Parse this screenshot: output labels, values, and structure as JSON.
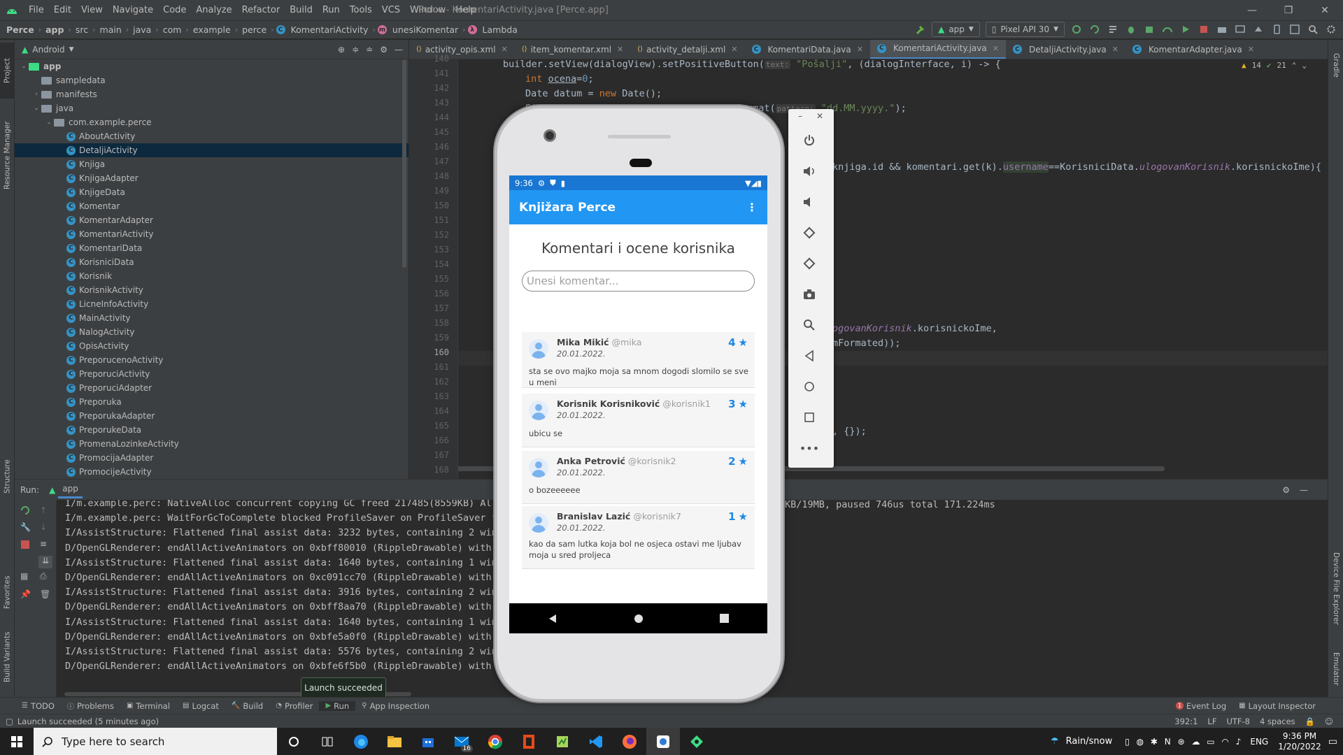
{
  "menu": {
    "items": [
      "File",
      "Edit",
      "View",
      "Navigate",
      "Code",
      "Analyze",
      "Refactor",
      "Build",
      "Run",
      "Tools",
      "VCS",
      "Window",
      "Help"
    ]
  },
  "window_title": "Perce - KomentariActivity.java [Perce.app]",
  "breadcrumb": [
    "Perce",
    "app",
    "src",
    "main",
    "java",
    "com",
    "example",
    "perce",
    "KomentariActivity",
    "unesiKomentar",
    "Lambda"
  ],
  "toolbar": {
    "run_config": "app",
    "device": "Pixel API 30"
  },
  "project_panel": {
    "view_mode": "Android",
    "tree": [
      {
        "label": "app",
        "type": "folder",
        "depth": 0,
        "open": true
      },
      {
        "label": "sampledata",
        "type": "folder",
        "depth": 1
      },
      {
        "label": "manifests",
        "type": "folder",
        "depth": 1,
        "collapsed": true
      },
      {
        "label": "java",
        "type": "folder",
        "depth": 1,
        "open": true
      },
      {
        "label": "com.example.perce",
        "type": "package",
        "depth": 2,
        "open": true
      },
      {
        "label": "AboutActivity",
        "type": "class",
        "depth": 3
      },
      {
        "label": "DetaljiActivity",
        "type": "class",
        "depth": 3,
        "selected": true
      },
      {
        "label": "Knjiga",
        "type": "class",
        "depth": 3
      },
      {
        "label": "KnjigaAdapter",
        "type": "class",
        "depth": 3
      },
      {
        "label": "KnjigeData",
        "type": "class",
        "depth": 3
      },
      {
        "label": "Komentar",
        "type": "class",
        "depth": 3
      },
      {
        "label": "KomentarAdapter",
        "type": "class",
        "depth": 3
      },
      {
        "label": "KomentariActivity",
        "type": "class",
        "depth": 3
      },
      {
        "label": "KomentariData",
        "type": "class",
        "depth": 3
      },
      {
        "label": "KorisniciData",
        "type": "class",
        "depth": 3
      },
      {
        "label": "Korisnik",
        "type": "class",
        "depth": 3
      },
      {
        "label": "KorisnikActivity",
        "type": "class",
        "depth": 3
      },
      {
        "label": "LicneInfoActivity",
        "type": "class",
        "depth": 3
      },
      {
        "label": "MainActivity",
        "type": "class",
        "depth": 3
      },
      {
        "label": "NalogActivity",
        "type": "class",
        "depth": 3
      },
      {
        "label": "OpisActivity",
        "type": "class",
        "depth": 3
      },
      {
        "label": "PreporucenoActivity",
        "type": "class",
        "depth": 3
      },
      {
        "label": "PreporuciActivity",
        "type": "class",
        "depth": 3
      },
      {
        "label": "PreporuciAdapter",
        "type": "class",
        "depth": 3
      },
      {
        "label": "Preporuka",
        "type": "class",
        "depth": 3
      },
      {
        "label": "PreporukaAdapter",
        "type": "class",
        "depth": 3
      },
      {
        "label": "PreporukeData",
        "type": "class",
        "depth": 3
      },
      {
        "label": "PromenaLozinkeActivity",
        "type": "class",
        "depth": 3
      },
      {
        "label": "PromocijaAdapter",
        "type": "class",
        "depth": 3
      },
      {
        "label": "PromocijeActivity",
        "type": "class",
        "depth": 3
      }
    ]
  },
  "editor_tabs": [
    {
      "label": "activity_opis.xml",
      "kind": "xml"
    },
    {
      "label": "item_komentar.xml",
      "kind": "xml"
    },
    {
      "label": "activity_detalji.xml",
      "kind": "xml"
    },
    {
      "label": "KomentariData.java",
      "kind": "java"
    },
    {
      "label": "KomentariActivity.java",
      "kind": "java",
      "active": true
    },
    {
      "label": "DetaljiActivity.java",
      "kind": "java"
    },
    {
      "label": "KomentarAdapter.java",
      "kind": "java"
    }
  ],
  "editor": {
    "line_numbers": [
      "140",
      "141",
      "142",
      "143",
      "144",
      "145",
      "146",
      "147",
      "148",
      "149",
      "150",
      "151",
      "152",
      "153",
      "154",
      "155",
      "156",
      "157",
      "158",
      "159",
      "160",
      "161",
      "162",
      "163",
      "164",
      "165",
      "166",
      "167",
      "168"
    ],
    "current_line": "160",
    "warnings": "14",
    "checks": "21",
    "code": {
      "l140a": "builder.setView(dialogView).setPositiveButton(",
      "l140hint": "text:",
      "l140str": "\"Pošalji\"",
      "l140b": ", (dialogInterface, i) -> {",
      "l141kw": "int",
      "l141var": "ocena",
      "l141rest": "=",
      "l141num": "0",
      "l142a": "Date datum = ",
      "l142kw": "new",
      "l142b": " Date();",
      "l143a": "SimpleDateFormat sdf = ",
      "l143kw": "new",
      "l143b": " SimpleDateFormat(",
      "l143hint": "pattern:",
      "l143str": "\"dd.MM.yyyy.\"",
      "l143c": ");",
      "l147a": "knjiga.id && komentari.get(k).",
      "l147fld": "username",
      "l147b": "==KorisniciData.",
      "l147fld2": "ulogovanKorisnik",
      "l147c": ".korisnickoIme){",
      "l158a": "ogovanKorisnik",
      "l158b": ".korisnickoIme,",
      "l159": "mFormated));",
      "l167": ", {});"
    }
  },
  "run_panel": {
    "label": "Run:",
    "config": "app",
    "lines": [
      "I/m.example.perc: NativeAlloc concurrent copying GC freed 217485(8559KB) Allo",
      "I/m.example.perc: WaitForGcToComplete blocked ProfileSaver on ProfileSaver fo",
      "I/AssistStructure: Flattened final assist data: 3232 bytes, containing 2 wind",
      "D/OpenGLRenderer: endAllActiveAnimators on 0xbff80010 (RippleDrawable) with h",
      "I/AssistStructure: Flattened final assist data: 1640 bytes, containing 1 wind",
      "D/OpenGLRenderer: endAllActiveAnimators on 0xc091cc70 (RippleDrawable) with h",
      "I/AssistStructure: Flattened final assist data: 3916 bytes, containing 2 wind",
      "D/OpenGLRenderer: endAllActiveAnimators on 0xbff8aa70 (RippleDrawable) with h",
      "I/AssistStructure: Flattened final assist data: 1640 bytes, containing 1 wind",
      "D/OpenGLRenderer: endAllActiveAnimators on 0xbfe5a0f0 (RippleDrawable) with h",
      "I/AssistStructure: Flattened final assist data: 5576 bytes, containing 2 wind",
      "D/OpenGLRenderer: endAllActiveAnimators on 0xbfe6f5b0 (RippleDrawable) with h"
    ],
    "line1_tail": "KB/19MB, paused 746us total 171.224ms"
  },
  "toast": "Launch succeeded",
  "bottom_tools": [
    "TODO",
    "Problems",
    "Terminal",
    "Logcat",
    "Build",
    "Profiler",
    "Run",
    "App Inspection"
  ],
  "bottom_right_tools": [
    "Event Log",
    "Layout Inspector"
  ],
  "status": {
    "message": "Launch succeeded (5 minutes ago)",
    "position": "392:1",
    "line_sep": "LF",
    "encoding": "UTF-8",
    "indent": "4 spaces"
  },
  "left_vertical_tabs": [
    "Project",
    "Resource Manager",
    "Structure",
    "Favorites",
    "Build Variants"
  ],
  "right_vertical_tabs": [
    "Gradle",
    "Device File Explorer",
    "Emulator"
  ],
  "phone": {
    "time": "9:36",
    "app_title": "Knjižara Perce",
    "page_title": "Komentari i ocene korisnika",
    "input_placeholder": "Unesi komentar...",
    "comments": [
      {
        "name": "Mika Mikić",
        "user": "@mika",
        "date": "20.01.2022.",
        "rating": "4",
        "text": "sta se ovo majko moja sa mnom dogodi slomilo se sve u meni"
      },
      {
        "name": "Korisnik Korisniković",
        "user": "@korisnik1",
        "date": "20.01.2022.",
        "rating": "3",
        "text": "ubicu se"
      },
      {
        "name": "Anka Petrović",
        "user": "@korisnik2",
        "date": "20.01.2022.",
        "rating": "2",
        "text": "o bozeeeeee"
      },
      {
        "name": "Branislav Lazić",
        "user": "@korisnik7",
        "date": "20.01.2022.",
        "rating": "1",
        "text": "kao da sam lutka koja bol ne osjeca ostavi me ljubav moja u sred proljeca"
      }
    ]
  },
  "taskbar": {
    "search_placeholder": "Type here to search",
    "mail_badge": "16",
    "weather": "Rain/snow",
    "lang": "ENG",
    "time": "9:36 PM",
    "date": "1/20/2022"
  },
  "colors": {
    "accent": "#2196f3",
    "star": "#1e88e5",
    "selection": "#0d293e"
  }
}
